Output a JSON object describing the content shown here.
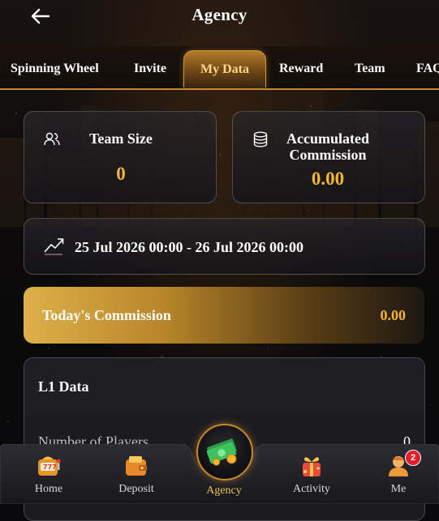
{
  "header": {
    "title": "Agency"
  },
  "tabs": [
    {
      "label": "Spinning Wheel"
    },
    {
      "label": "Invite"
    },
    {
      "label": "My Data",
      "active": true
    },
    {
      "label": "Reward"
    },
    {
      "label": "Team"
    },
    {
      "label": "FAQ"
    }
  ],
  "stats": {
    "team_size": {
      "label": "Team Size",
      "value": "0"
    },
    "accumulated_commission": {
      "label_line1": "Accumulated",
      "label_line2": "Commission",
      "value": "0.00"
    }
  },
  "date_range": "25 Jul 2026 00:00 - 26 Jul 2026 00:00",
  "today_commission": {
    "label": "Today's Commission",
    "value": "0.00"
  },
  "l1_data": {
    "title": "L1 Data",
    "rows": [
      {
        "label": "Number of Players",
        "value": "0"
      }
    ]
  },
  "nav": {
    "home": "Home",
    "deposit": "Deposit",
    "agency": "Agency",
    "activity": "Activity",
    "me": "Me",
    "me_badge": "2"
  },
  "colors": {
    "accent": "#f6b82e",
    "tab_border": "#c8892a",
    "badge": "#e41d2c"
  }
}
